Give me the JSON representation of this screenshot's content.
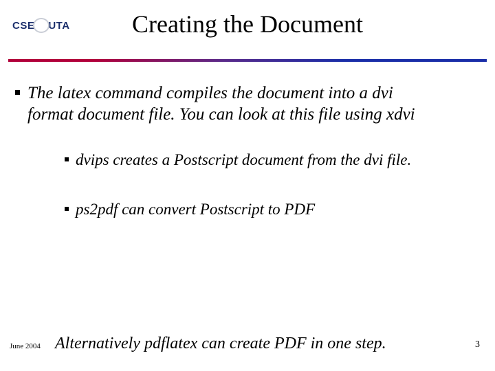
{
  "logo": {
    "left": "CSE",
    "right": "UTA"
  },
  "title": "Creating the Document",
  "bullets": {
    "main": "The latex command compiles the document into a dvi format document file. You can look at this file using xdvi",
    "sub1": "dvips creates a Postscript document from the dvi file.",
    "sub2": "ps2pdf can convert Postscript to PDF"
  },
  "lastline": "Alternatively pdflatex can create PDF in one step.",
  "footer": {
    "date": "June 2004",
    "page": "3"
  }
}
